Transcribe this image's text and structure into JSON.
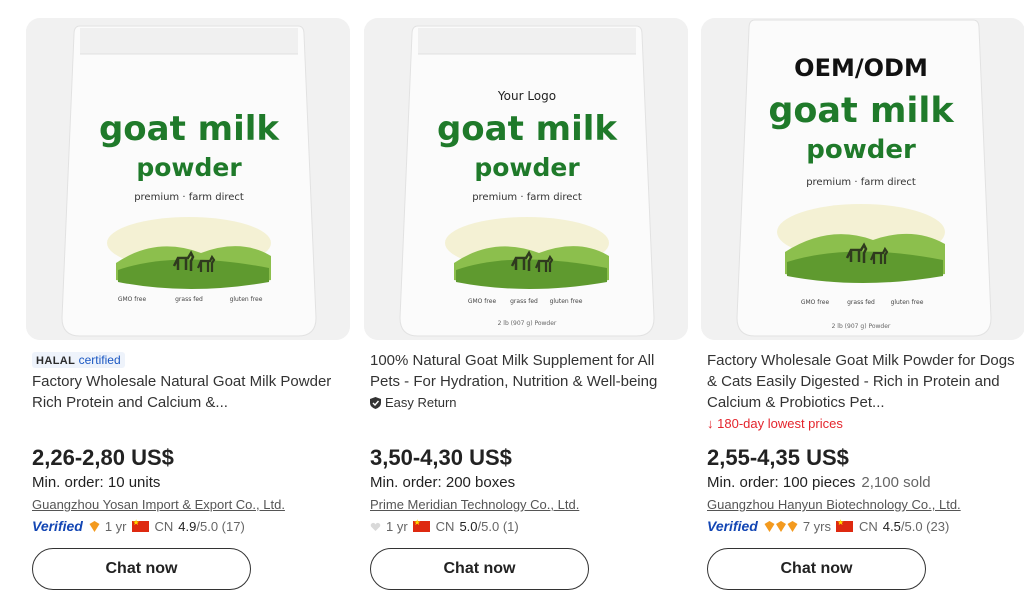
{
  "colors": {
    "accent_green": "#1f7a2a",
    "link_blue": "#1346b4",
    "alert_red": "#e4252d"
  },
  "products": [
    {
      "package": {
        "top_text": "",
        "brand_line1": "goat milk",
        "brand_line2": "powder",
        "tagline": "premium · farm direct",
        "features": [
          "GMO free",
          "grass fed",
          "gluten free"
        ],
        "weight": ""
      },
      "badge": {
        "part1": "HALAL",
        "part2": "certified"
      },
      "title": "Factory Wholesale Natural Goat Milk Powder Rich Protein and Calcium &...",
      "price": "2,26-2,80 US$",
      "min_order": "Min. order: 10 units",
      "sold": "",
      "supplier": "Guangzhou Yosan Import & Export Co., Ltd.",
      "verified": "Verified",
      "years": "1 yr",
      "country": "CN",
      "rating": "4.9",
      "rating_rest": "/5.0 (17)",
      "chat_label": "Chat now"
    },
    {
      "package": {
        "top_text": "Your Logo",
        "brand_line1": "goat milk",
        "brand_line2": "powder",
        "tagline": "premium · farm direct",
        "features": [
          "GMO free",
          "grass fed",
          "gluten free"
        ],
        "weight": "2 lb (907 g) Powder"
      },
      "title": "100% Natural Goat Milk Supplement for All Pets - For Hydration, Nutrition & Well-being",
      "return_label": "Easy Return",
      "price": "3,50-4,30 US$",
      "min_order": "Min. order: 200 boxes",
      "sold": "",
      "supplier": "Prime Meridian Technology Co., Ltd.",
      "years": "1 yr",
      "country": "CN",
      "rating": "5.0",
      "rating_rest": "/5.0 (1)",
      "chat_label": "Chat now"
    },
    {
      "package": {
        "top_text": "OEM/ODM",
        "brand_line1": "goat milk",
        "brand_line2": "powder",
        "tagline": "premium · farm direct",
        "features": [
          "GMO free",
          "grass fed",
          "gluten free"
        ],
        "weight": "2 lb (907 g) Powder"
      },
      "title": "Factory Wholesale Goat Milk Powder for Dogs & Cats Easily Digested - Rich in Protein and Calcium & Probiotics Pet...",
      "low_price_label": "180-day lowest prices",
      "price": "2,55-4,35 US$",
      "min_order": "Min. order: 100 pieces",
      "sold": "2,100 sold",
      "supplier": "Guangzhou Hanyun Biotechnology Co., Ltd.",
      "verified": "Verified",
      "years": "7 yrs",
      "country": "CN",
      "rating": "4.5",
      "rating_rest": "/5.0 (23)",
      "chat_label": "Chat now"
    }
  ]
}
